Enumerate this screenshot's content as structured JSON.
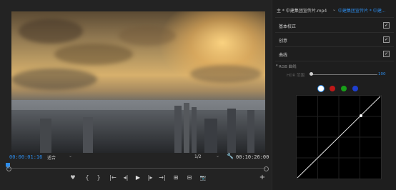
{
  "monitor": {
    "timecode_current": "00:00:01:16",
    "fit_label": "适合",
    "resolution_label": "1/2",
    "timecode_total": "00:10:26:00",
    "transport": [
      "♥",
      "{",
      "}",
      "|←",
      "◂|",
      "▶",
      "|▸",
      "→|",
      "⊞",
      "⊟",
      "📷",
      "+"
    ]
  },
  "lumetri": {
    "header_main": "主 * 中建集团宣传片.mp4",
    "header_seq": "中建集团宣传片 * 中建...",
    "sections": [
      {
        "label": "基本校正",
        "checked": true
      },
      {
        "label": "创意",
        "checked": true
      },
      {
        "label": "曲线",
        "checked": true
      }
    ],
    "rgb_curves_title": "RGB 曲线",
    "hdr_range_label": "HDR 范围",
    "hdr_range_value": "100",
    "channels": [
      {
        "name": "white",
        "color": "#ffffff"
      },
      {
        "name": "red",
        "color": "#c01818"
      },
      {
        "name": "green",
        "color": "#18a018"
      },
      {
        "name": "blue",
        "color": "#1e3fd0"
      }
    ]
  },
  "colors": {
    "accent": "#2d8ceb"
  }
}
